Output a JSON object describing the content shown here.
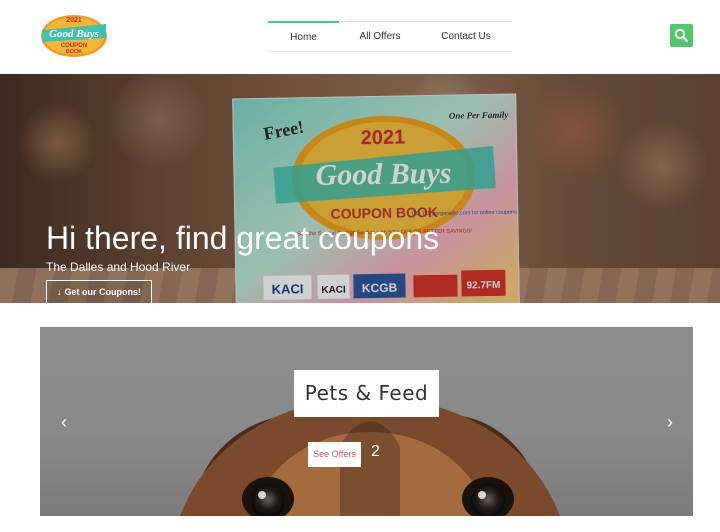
{
  "logo": {
    "year": "2021",
    "brand": "Good Buys",
    "line1": "COUPON",
    "line2": "BOOK"
  },
  "nav": {
    "items": [
      {
        "label": "Home",
        "active": true
      },
      {
        "label": "All Offers",
        "active": false
      },
      {
        "label": "Contact Us",
        "active": false
      }
    ],
    "search_icon": "search-icon",
    "accent": "#3cc4a4",
    "search_color": "#4fc86a"
  },
  "hero": {
    "title": "Hi there, find great coupons",
    "subtitle": "The Dalles and Hood River",
    "button_label": "Get our Coupons!",
    "button_icon": "arrow-down-icon",
    "book": {
      "free": "Free!",
      "year": "2021",
      "brand": "Good Buys",
      "heading": "COUPON BOOK",
      "corner": "One Per Family",
      "special": "See the Special Orange Section with 50% OFF OR BETTER SAVINGS!",
      "goto": "GO TO: gorgeradio.com for online coupons",
      "stations": [
        "KACI",
        "KACI",
        "KCGB",
        "92.7FM"
      ]
    }
  },
  "carousel": {
    "slide_title": "Pets & Feed",
    "button_label": "See Offers",
    "number": "2",
    "prev_icon": "chevron-left-icon",
    "next_icon": "chevron-right-icon",
    "button_color": "#d2546a"
  }
}
